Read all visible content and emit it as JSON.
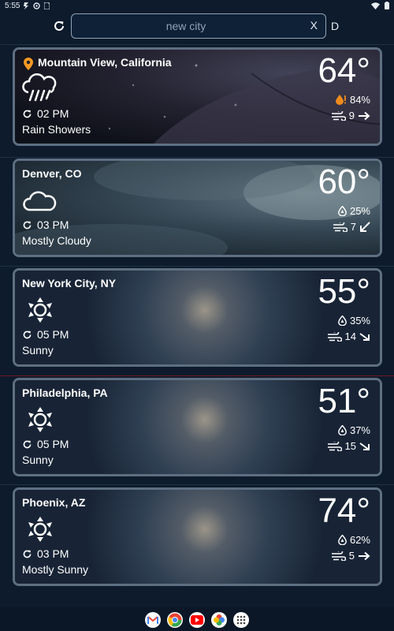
{
  "status_bar": {
    "time": "5:55"
  },
  "search": {
    "placeholder": "new city",
    "clear_label": "X",
    "d_label": "D"
  },
  "cities": [
    {
      "name": "Mountain View, California",
      "time": "02 PM",
      "condition": "Rain Showers",
      "temperature": "64°",
      "humidity": "84%",
      "wind": "9",
      "icon": "rain-icon",
      "humidity_alert": true,
      "current_location": true
    },
    {
      "name": "Denver, CO",
      "time": "03 PM",
      "condition": "Mostly Cloudy",
      "temperature": "60°",
      "humidity": "25%",
      "wind": "7",
      "icon": "cloud-icon"
    },
    {
      "name": "New York City, NY",
      "time": "05 PM",
      "condition": "Sunny",
      "temperature": "55°",
      "humidity": "35%",
      "wind": "14",
      "icon": "sun-icon"
    },
    {
      "name": "Philadelphia, PA",
      "time": "05 PM",
      "condition": "Sunny",
      "temperature": "51°",
      "humidity": "37%",
      "wind": "15",
      "icon": "sun-icon"
    },
    {
      "name": "Phoenix, AZ",
      "time": "03 PM",
      "condition": "Mostly Sunny",
      "temperature": "74°",
      "humidity": "62%",
      "wind": "5",
      "icon": "sun-icon"
    }
  ],
  "colors": {
    "background": "#0e1b2c",
    "card_border": "#5e6f82",
    "pin": "#f59a22",
    "alert": "#f08a1c"
  },
  "dock_apps": [
    "gmail-icon",
    "chrome-icon",
    "youtube-icon",
    "photos-icon",
    "app-drawer-icon"
  ]
}
